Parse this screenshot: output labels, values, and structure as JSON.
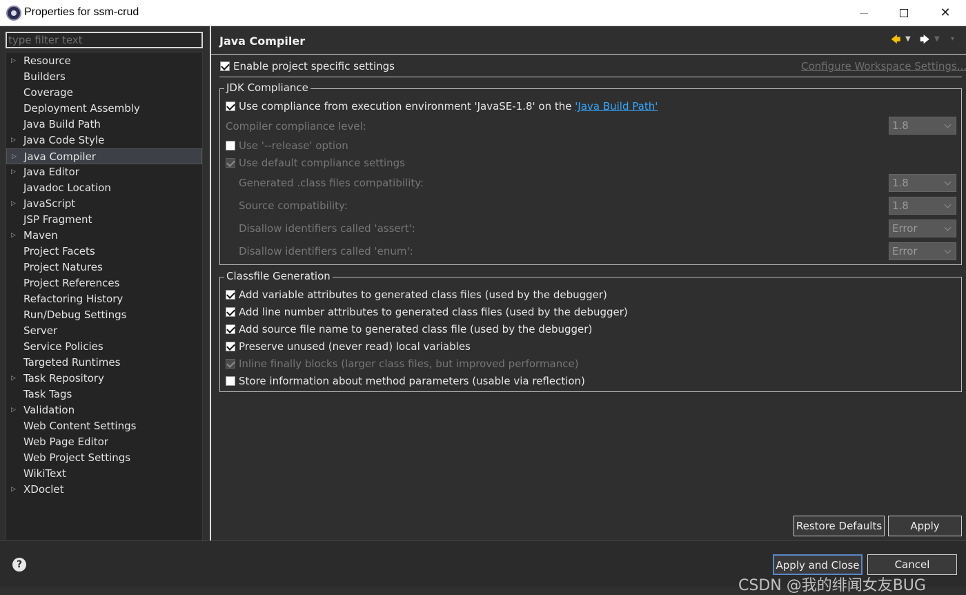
{
  "window": {
    "title": "Properties for ssm-crud",
    "minimize": "—",
    "maximize": "☐",
    "close": "✕"
  },
  "sidebar": {
    "filter_placeholder": "type filter text",
    "items": [
      {
        "label": "Resource",
        "expandable": true
      },
      {
        "label": "Builders",
        "expandable": false
      },
      {
        "label": "Coverage",
        "expandable": false
      },
      {
        "label": "Deployment Assembly",
        "expandable": false
      },
      {
        "label": "Java Build Path",
        "expandable": false
      },
      {
        "label": "Java Code Style",
        "expandable": true
      },
      {
        "label": "Java Compiler",
        "expandable": true,
        "selected": true
      },
      {
        "label": "Java Editor",
        "expandable": true
      },
      {
        "label": "Javadoc Location",
        "expandable": false
      },
      {
        "label": "JavaScript",
        "expandable": true
      },
      {
        "label": "JSP Fragment",
        "expandable": false
      },
      {
        "label": "Maven",
        "expandable": true
      },
      {
        "label": "Project Facets",
        "expandable": false
      },
      {
        "label": "Project Natures",
        "expandable": false
      },
      {
        "label": "Project References",
        "expandable": false
      },
      {
        "label": "Refactoring History",
        "expandable": false
      },
      {
        "label": "Run/Debug Settings",
        "expandable": false
      },
      {
        "label": "Server",
        "expandable": false
      },
      {
        "label": "Service Policies",
        "expandable": false
      },
      {
        "label": "Targeted Runtimes",
        "expandable": false
      },
      {
        "label": "Task Repository",
        "expandable": true
      },
      {
        "label": "Task Tags",
        "expandable": false
      },
      {
        "label": "Validation",
        "expandable": true
      },
      {
        "label": "Web Content Settings",
        "expandable": false
      },
      {
        "label": "Web Page Editor",
        "expandable": false
      },
      {
        "label": "Web Project Settings",
        "expandable": false
      },
      {
        "label": "WikiText",
        "expandable": false
      },
      {
        "label": "XDoclet",
        "expandable": true
      }
    ]
  },
  "main": {
    "title": "Java Compiler",
    "enable_project_specific": "Enable project specific settings",
    "configure_workspace_link": "Configure Workspace Settings...",
    "jdk": {
      "group_title": "JDK Compliance",
      "use_compliance_prefix": "Use compliance from execution environment 'JavaSE-1.8' on the ",
      "java_build_path_link": "'Java Build Path'",
      "compliance_level_label": "Compiler compliance level:",
      "compliance_level_value": "1.8",
      "release_option": "Use '--release' option",
      "default_compliance": "Use default compliance settings",
      "generated_class_label": "Generated .class files compatibility:",
      "generated_class_value": "1.8",
      "source_compat_label": "Source compatibility:",
      "source_compat_value": "1.8",
      "assert_label": "Disallow identifiers called 'assert':",
      "assert_value": "Error",
      "enum_label": "Disallow identifiers called 'enum':",
      "enum_value": "Error"
    },
    "classfile": {
      "group_title": "Classfile Generation",
      "options": [
        {
          "label": "Add variable attributes to generated class files (used by the debugger)",
          "checked": true,
          "disabled": false
        },
        {
          "label": "Add line number attributes to generated class files (used by the debugger)",
          "checked": true,
          "disabled": false
        },
        {
          "label": "Add source file name to generated class file (used by the debugger)",
          "checked": true,
          "disabled": false
        },
        {
          "label": "Preserve unused (never read) local variables",
          "checked": true,
          "disabled": false
        },
        {
          "label": "Inline finally blocks (larger class files, but improved performance)",
          "checked": true,
          "disabled": true
        },
        {
          "label": "Store information about method parameters (usable via reflection)",
          "checked": false,
          "disabled": false
        }
      ]
    },
    "restore_defaults": "Restore Defaults",
    "apply": "Apply"
  },
  "footer": {
    "help": "?",
    "apply_and_close": "Apply and Close",
    "cancel": "Cancel",
    "watermark": "CSDN @我的绯闻女友BUG"
  }
}
